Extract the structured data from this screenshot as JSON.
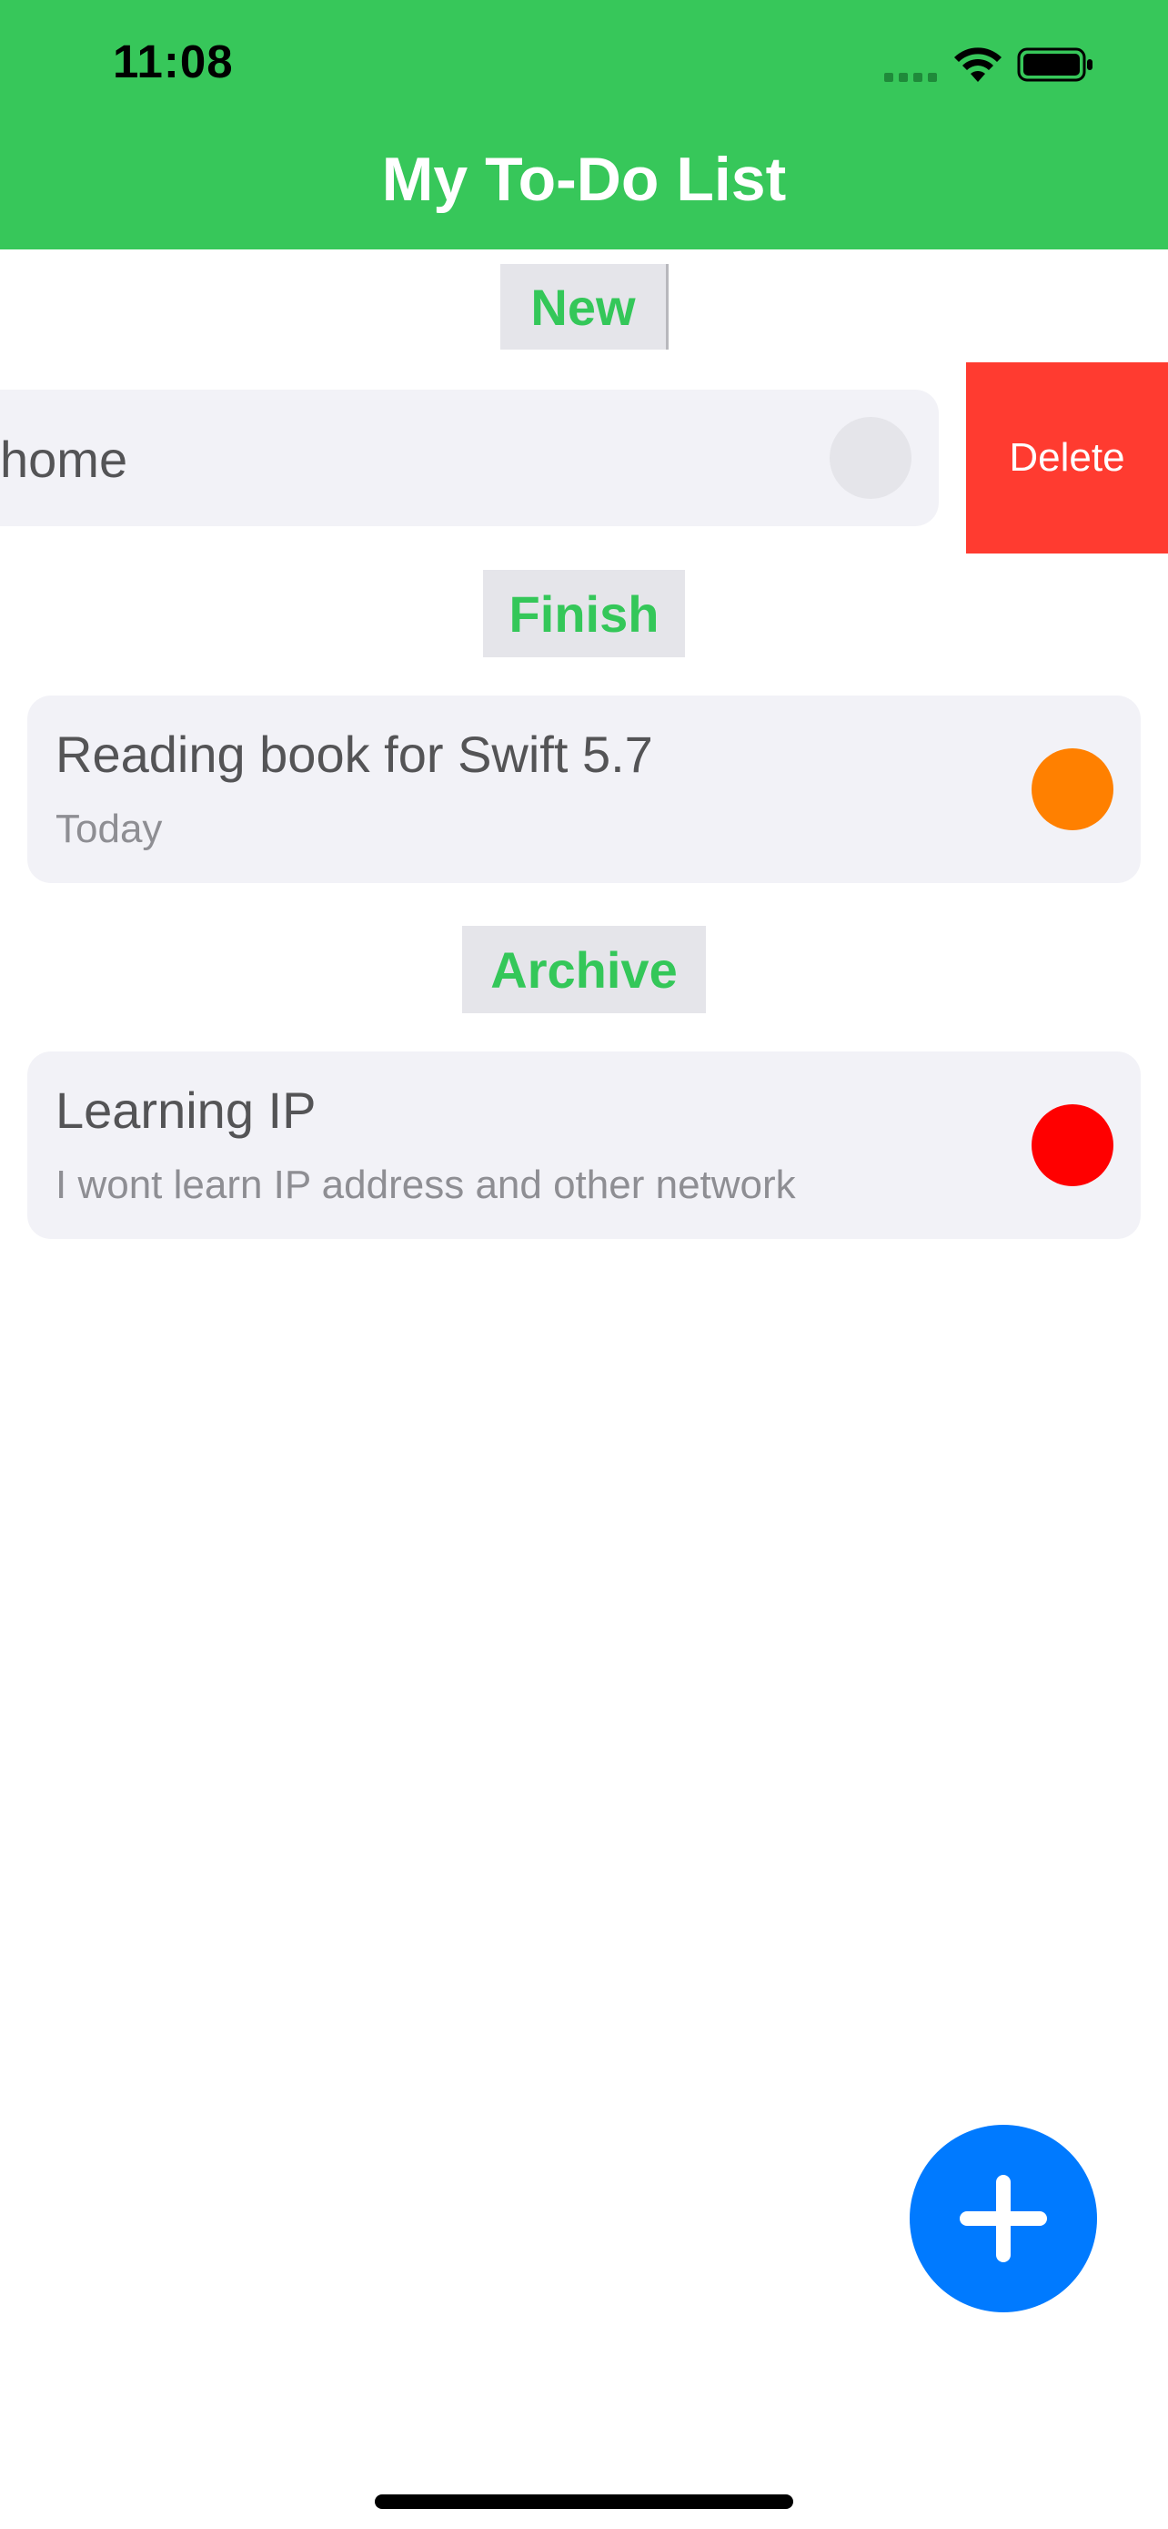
{
  "status_bar": {
    "time": "11:08"
  },
  "header": {
    "title": "My To-Do List",
    "background_color": "#37c75a"
  },
  "sections": {
    "new": {
      "label": "New",
      "items": [
        {
          "title": "home",
          "status_color": "#e5e5ea",
          "swipe_action": "Delete"
        }
      ]
    },
    "finish": {
      "label": "Finish",
      "items": [
        {
          "title": "Reading book for Swift 5.7",
          "subtitle": "Today",
          "status_color": "#ff8000"
        }
      ]
    },
    "archive": {
      "label": "Archive",
      "items": [
        {
          "title": "Learning IP",
          "subtitle": "I wont learn IP address and other network",
          "status_color": "#ff0000"
        }
      ]
    }
  },
  "colors": {
    "accent": "#34c759",
    "delete": "#ff3b30",
    "fab": "#007aff"
  },
  "icons": {
    "fab": "plus-icon",
    "status": [
      "signal-icon",
      "wifi-icon",
      "battery-icon"
    ]
  }
}
